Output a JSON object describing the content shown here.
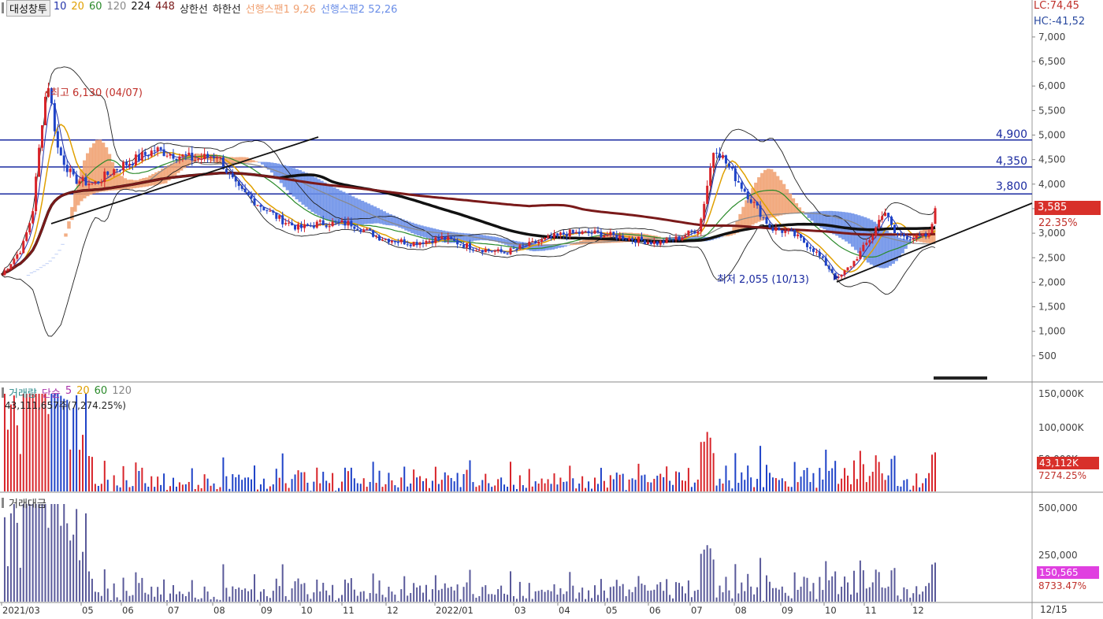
{
  "title_button": "대성창투",
  "legend": [
    {
      "label": "10",
      "color": "#2233aa"
    },
    {
      "label": "20",
      "color": "#e0a000"
    },
    {
      "label": "60",
      "color": "#2a8a2a"
    },
    {
      "label": "120",
      "color": "#888888"
    },
    {
      "label": "224",
      "color": "#111111"
    },
    {
      "label": "448",
      "color": "#7a1a1a"
    },
    {
      "label": "상한선",
      "color": "#222222"
    },
    {
      "label": "하한선",
      "color": "#222222"
    },
    {
      "label": "선행스팬1 9,26",
      "color": "#f0a070"
    },
    {
      "label": "선행스팬2 52,26",
      "color": "#6a8ee8"
    }
  ],
  "lc_label": "LC:74,45",
  "hc_label": "HC:-41,52",
  "price_axis_ticks": [
    "7,000",
    "6,500",
    "6,000",
    "5,500",
    "5,000",
    "4,500",
    "4,000",
    "3,500",
    "3,000",
    "2,500",
    "2,000",
    "1,500",
    "1,000",
    "500"
  ],
  "hlines": [
    "4,900",
    "4,350",
    "3,800"
  ],
  "high_annotation": "최고 6,130 (04/07)",
  "low_annotation": "최저 2,055 (10/13)",
  "current_price": "3,585",
  "current_change": "22.35%",
  "volume_panel": {
    "legend": [
      {
        "label": "거래량",
        "color": "#2a8a8a"
      },
      {
        "label": "단순",
        "color": "#aa33aa"
      },
      {
        "label": "5",
        "color": "#aa33aa"
      },
      {
        "label": "20",
        "color": "#e0a000"
      },
      {
        "label": "60",
        "color": "#2a8a2a"
      },
      {
        "label": "120",
        "color": "#888888"
      }
    ],
    "info": "43,111,657주(7,274.25%)",
    "axis_ticks": [
      "150,000K",
      "100,000K",
      "50,000K"
    ],
    "current_value": "43,112K",
    "current_pct": "7274.25%"
  },
  "amount_panel": {
    "legend": [
      {
        "label": "거래대금",
        "color": "#333333"
      }
    ],
    "axis_ticks": [
      "500,000",
      "250,000"
    ],
    "current_value": "150,565",
    "current_pct": "8733.47%"
  },
  "x_ticks": [
    "2021/03",
    "05",
    "06",
    "07",
    "08",
    "09",
    "10",
    "11",
    "12",
    "2022/01",
    "03",
    "04",
    "05",
    "06",
    "07",
    "08",
    "09",
    "10",
    "11",
    "12"
  ],
  "x_end_label": "12/15",
  "colors": {
    "up": "#d8242a",
    "down": "#1f43c8",
    "hline": "#1a2aa0",
    "span1": "#f0a070",
    "span2": "#6a8ee8"
  },
  "chart_data": {
    "type": "candlestick",
    "y_range": [
      0,
      7400
    ],
    "horizontal_levels": [
      4900,
      4350,
      3800
    ],
    "anchors": [
      {
        "x": 0.0,
        "p": 2150
      },
      {
        "x": 0.02,
        "p": 2700
      },
      {
        "x": 0.03,
        "p": 3400
      },
      {
        "x": 0.04,
        "p": 5400
      },
      {
        "x": 0.045,
        "p": 6130
      },
      {
        "x": 0.055,
        "p": 4700
      },
      {
        "x": 0.07,
        "p": 4100
      },
      {
        "x": 0.09,
        "p": 4000
      },
      {
        "x": 0.11,
        "p": 4300
      },
      {
        "x": 0.13,
        "p": 4500
      },
      {
        "x": 0.15,
        "p": 4700
      },
      {
        "x": 0.17,
        "p": 4600
      },
      {
        "x": 0.19,
        "p": 4500
      },
      {
        "x": 0.21,
        "p": 4600
      },
      {
        "x": 0.23,
        "p": 3900
      },
      {
        "x": 0.25,
        "p": 3600
      },
      {
        "x": 0.27,
        "p": 3300
      },
      {
        "x": 0.29,
        "p": 3100
      },
      {
        "x": 0.31,
        "p": 3200
      },
      {
        "x": 0.34,
        "p": 3200
      },
      {
        "x": 0.37,
        "p": 2900
      },
      {
        "x": 0.4,
        "p": 2800
      },
      {
        "x": 0.43,
        "p": 2900
      },
      {
        "x": 0.46,
        "p": 2700
      },
      {
        "x": 0.49,
        "p": 2600
      },
      {
        "x": 0.52,
        "p": 2800
      },
      {
        "x": 0.55,
        "p": 3000
      },
      {
        "x": 0.58,
        "p": 3000
      },
      {
        "x": 0.61,
        "p": 2900
      },
      {
        "x": 0.64,
        "p": 2800
      },
      {
        "x": 0.66,
        "p": 2900
      },
      {
        "x": 0.68,
        "p": 3100
      },
      {
        "x": 0.695,
        "p": 4800
      },
      {
        "x": 0.71,
        "p": 4300
      },
      {
        "x": 0.73,
        "p": 3700
      },
      {
        "x": 0.75,
        "p": 3100
      },
      {
        "x": 0.77,
        "p": 3000
      },
      {
        "x": 0.79,
        "p": 2700
      },
      {
        "x": 0.81,
        "p": 2200
      },
      {
        "x": 0.815,
        "p": 2055
      },
      {
        "x": 0.83,
        "p": 2400
      },
      {
        "x": 0.85,
        "p": 3000
      },
      {
        "x": 0.86,
        "p": 3500
      },
      {
        "x": 0.87,
        "p": 3000
      },
      {
        "x": 0.89,
        "p": 2900
      },
      {
        "x": 0.905,
        "p": 2950
      },
      {
        "x": 0.91,
        "p": 3585
      }
    ]
  }
}
